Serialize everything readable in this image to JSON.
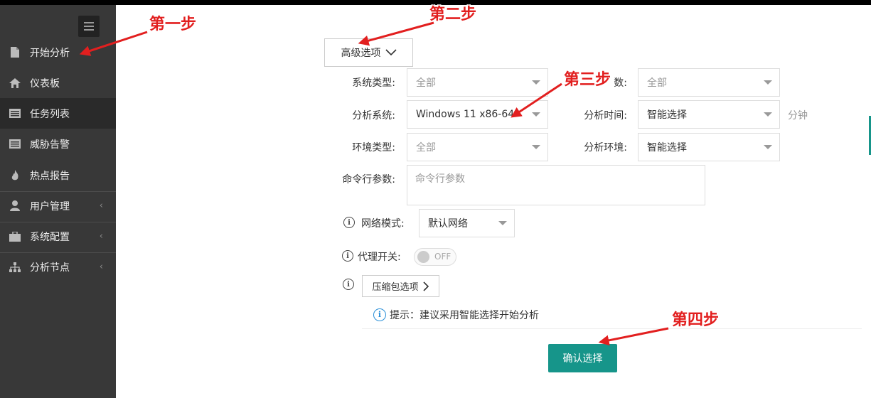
{
  "sidebar": {
    "items": [
      {
        "label": "开始分析",
        "icon": "file-icon"
      },
      {
        "label": "仪表板",
        "icon": "home-icon"
      },
      {
        "label": "任务列表",
        "icon": "list-icon"
      },
      {
        "label": "威胁告警",
        "icon": "list-icon"
      },
      {
        "label": "热点报告",
        "icon": "fire-icon"
      },
      {
        "label": "用户管理",
        "icon": "user-icon",
        "caret": "‹"
      },
      {
        "label": "系统配置",
        "icon": "briefcase-icon",
        "caret": "‹"
      },
      {
        "label": "分析节点",
        "icon": "sitemap-icon",
        "caret": "‹"
      }
    ]
  },
  "form": {
    "advanced_label": "高级选项",
    "system_type_label": "系统类型:",
    "system_type_value": "全部",
    "cpu_label": "数:",
    "cpu_value": "全部",
    "analysis_system_label": "分析系统:",
    "analysis_system_value": "Windows 11 x86-64",
    "analysis_time_label": "分析时间:",
    "analysis_time_value": "智能选择",
    "analysis_time_unit": "分钟",
    "env_type_label": "环境类型:",
    "env_type_value": "全部",
    "analysis_env_label": "分析环境:",
    "analysis_env_value": "智能选择",
    "cmdline_label": "命令行参数:",
    "cmdline_placeholder": "命令行参数",
    "network_label": "网络模式:",
    "network_value": "默认网络",
    "proxy_label": "代理开关:",
    "proxy_state": "OFF",
    "zip_label": "压缩包选项",
    "tip_text": "提示：建议采用智能选择开始分析",
    "confirm_label": "确认选择"
  },
  "annotations": {
    "step1": "第一步",
    "step2": "第二步",
    "step3": "第三步",
    "step4": "第四步"
  },
  "colors": {
    "sidebar_bg": "#383838",
    "accent": "#16958a",
    "annotation": "#e21f1f",
    "tip_icon": "#2a8fd8"
  }
}
